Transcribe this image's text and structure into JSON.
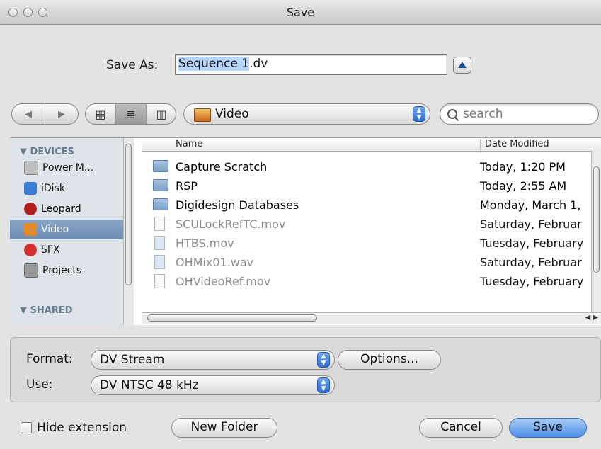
{
  "window": {
    "title": "Save"
  },
  "save_as": {
    "label": "Save As:",
    "filename_selected": "Sequence 1",
    "filename_ext": ".dv"
  },
  "toolbar": {
    "back_label": "◀",
    "forward_label": "▶",
    "view_icon_label": "▦",
    "view_list_label": "≣",
    "view_column_label": "▥",
    "location": "Video",
    "search_placeholder": "search"
  },
  "sidebar": {
    "devices_header": "▼ DEVICES",
    "shared_header": "▼ SHARED",
    "items": [
      {
        "label": "Power M...",
        "icon": "hard-drive-icon",
        "color": "#bfbfbf"
      },
      {
        "label": "iDisk",
        "icon": "idisk-icon",
        "color": "#3b7bd4"
      },
      {
        "label": "Leopard",
        "icon": "leopard-disk-icon",
        "color": "#b21e1e"
      },
      {
        "label": "Video",
        "icon": "video-folder-icon",
        "color": "#e08a2a",
        "selected": true
      },
      {
        "label": "SFX",
        "icon": "sfx-drive-icon",
        "color": "#d43030"
      },
      {
        "label": "Projects",
        "icon": "projects-drive-icon",
        "color": "#999999"
      }
    ]
  },
  "file_list": {
    "col_name": "Name",
    "col_date": "Date Modified",
    "rows": [
      {
        "name": "Capture Scratch",
        "date": "Today, 1:20 PM",
        "kind": "folder"
      },
      {
        "name": "RSP",
        "date": "Today, 2:55 AM",
        "kind": "folder"
      },
      {
        "name": "Digidesign Databases",
        "date": "Monday, March 1,",
        "kind": "folder"
      },
      {
        "name": "SCULockRefTC.mov",
        "date": "Saturday, Februar",
        "kind": "file"
      },
      {
        "name": "HTBS.mov",
        "date": "Tuesday, February",
        "kind": "file"
      },
      {
        "name": "OHMix01.wav",
        "date": "Saturday, Februar",
        "kind": "file"
      },
      {
        "name": "OHVideoRef.mov",
        "date": "Tuesday, February",
        "kind": "file"
      }
    ]
  },
  "options": {
    "format_label": "Format:",
    "format_value": "DV Stream",
    "options_button": "Options...",
    "use_label": "Use:",
    "use_value": "DV NTSC 48 kHz"
  },
  "footer": {
    "hide_extension_label": "Hide extension",
    "new_folder_button": "New Folder",
    "cancel_button": "Cancel",
    "save_button": "Save"
  }
}
